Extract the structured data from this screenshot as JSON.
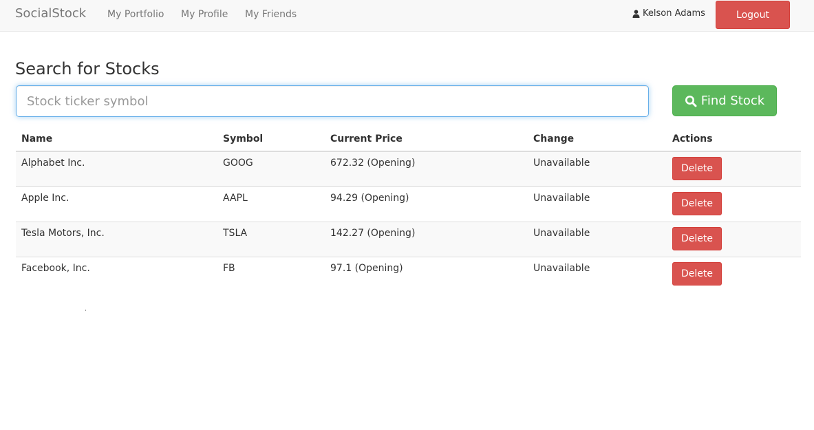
{
  "navbar": {
    "brand": "SocialStock",
    "links": [
      "My Portfolio",
      "My Profile",
      "My Friends"
    ],
    "user_name": "Kelson Adams",
    "user_icon": "user-icon",
    "logout_label": "Logout"
  },
  "search": {
    "title": "Search for Stocks",
    "placeholder": "Stock ticker symbol",
    "value": "",
    "button_label": "Find Stock",
    "button_icon": "search-icon"
  },
  "table": {
    "headers": [
      "Name",
      "Symbol",
      "Current Price",
      "Change",
      "Actions"
    ],
    "rows": [
      {
        "name": "Alphabet Inc.",
        "symbol": "GOOG",
        "price": "672.32 (Opening)",
        "change": "Unavailable",
        "action": "Delete"
      },
      {
        "name": "Apple Inc.",
        "symbol": "AAPL",
        "price": "94.29 (Opening)",
        "change": "Unavailable",
        "action": "Delete"
      },
      {
        "name": "Tesla Motors, Inc.",
        "symbol": "TSLA",
        "price": "142.27 (Opening)",
        "change": "Unavailable",
        "action": "Delete"
      },
      {
        "name": "Facebook, Inc.",
        "symbol": "FB",
        "price": "97.1 (Opening)",
        "change": "Unavailable",
        "action": "Delete"
      }
    ]
  },
  "colors": {
    "danger": "#d9534f",
    "success": "#5cb85c",
    "navbar_bg": "#f8f8f8",
    "focus_border": "#66afe9"
  }
}
